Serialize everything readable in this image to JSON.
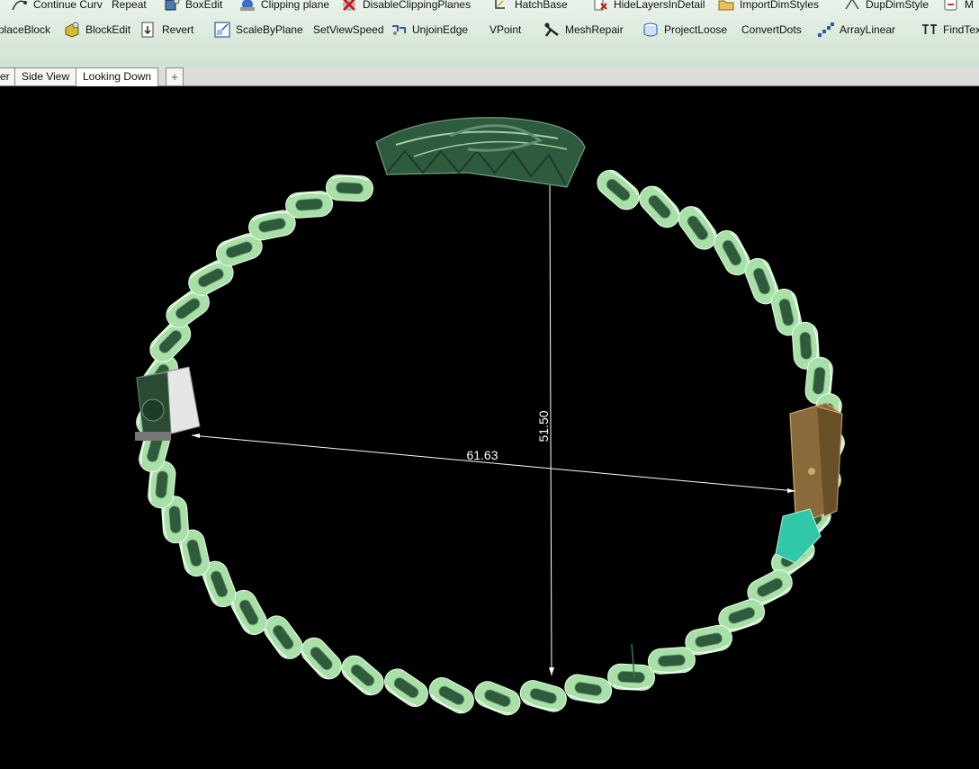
{
  "toolbar": {
    "row1": [
      {
        "label": "Continue Curv",
        "icon": "continue-curve-icon"
      },
      {
        "label": "Repeat",
        "icon": ""
      },
      {
        "label": "BoxEdit",
        "icon": "box-edit-icon"
      },
      {
        "label": "Clipping plane",
        "icon": "clipping-plane-icon"
      },
      {
        "label": "DisableClippingPlanes",
        "icon": "disable-clipping-icon"
      },
      {
        "label": "HatchBase",
        "icon": "hatch-base-icon"
      },
      {
        "label": "HideLayersInDetail",
        "icon": "hide-layers-icon"
      },
      {
        "label": "ImportDimStyles",
        "icon": "import-dim-styles-icon"
      },
      {
        "label": "DupDimStyle",
        "icon": "dup-dim-style-icon"
      },
      {
        "label": "M",
        "icon": "more-icon"
      }
    ],
    "row2": [
      {
        "label": "placeBlock",
        "icon": ""
      },
      {
        "label": "BlockEdit",
        "icon": "block-edit-icon"
      },
      {
        "label": "Revert",
        "icon": "revert-icon"
      },
      {
        "label": "ScaleByPlane",
        "icon": "scale-by-plane-icon"
      },
      {
        "label": "SetViewSpeed",
        "icon": ""
      },
      {
        "label": "UnjoinEdge",
        "icon": "unjoin-edge-icon"
      },
      {
        "label": "VPoint",
        "icon": ""
      },
      {
        "label": "MeshRepair",
        "icon": "mesh-repair-icon"
      },
      {
        "label": "ProjectLoose",
        "icon": "project-loose-icon"
      },
      {
        "label": "ConvertDots",
        "icon": ""
      },
      {
        "label": "ArrayLinear",
        "icon": "array-linear-icon"
      },
      {
        "label": "FindTex",
        "icon": "find-text-icon"
      }
    ]
  },
  "tabs": [
    {
      "label": "er"
    },
    {
      "label": "Side View"
    },
    {
      "label": "Looking Down"
    },
    {
      "label": "+"
    }
  ],
  "viewport": {
    "dimension_horizontal": "61.63",
    "dimension_vertical": "51.50",
    "colors": {
      "background": "#000000",
      "chain": "#a8e0a8",
      "chain_dark": "#2f5a3c",
      "top_part": "#2e5a3e",
      "clasp": "#8a6a3a",
      "accent": "#30c8a8",
      "dimension": "#ffffff"
    }
  }
}
